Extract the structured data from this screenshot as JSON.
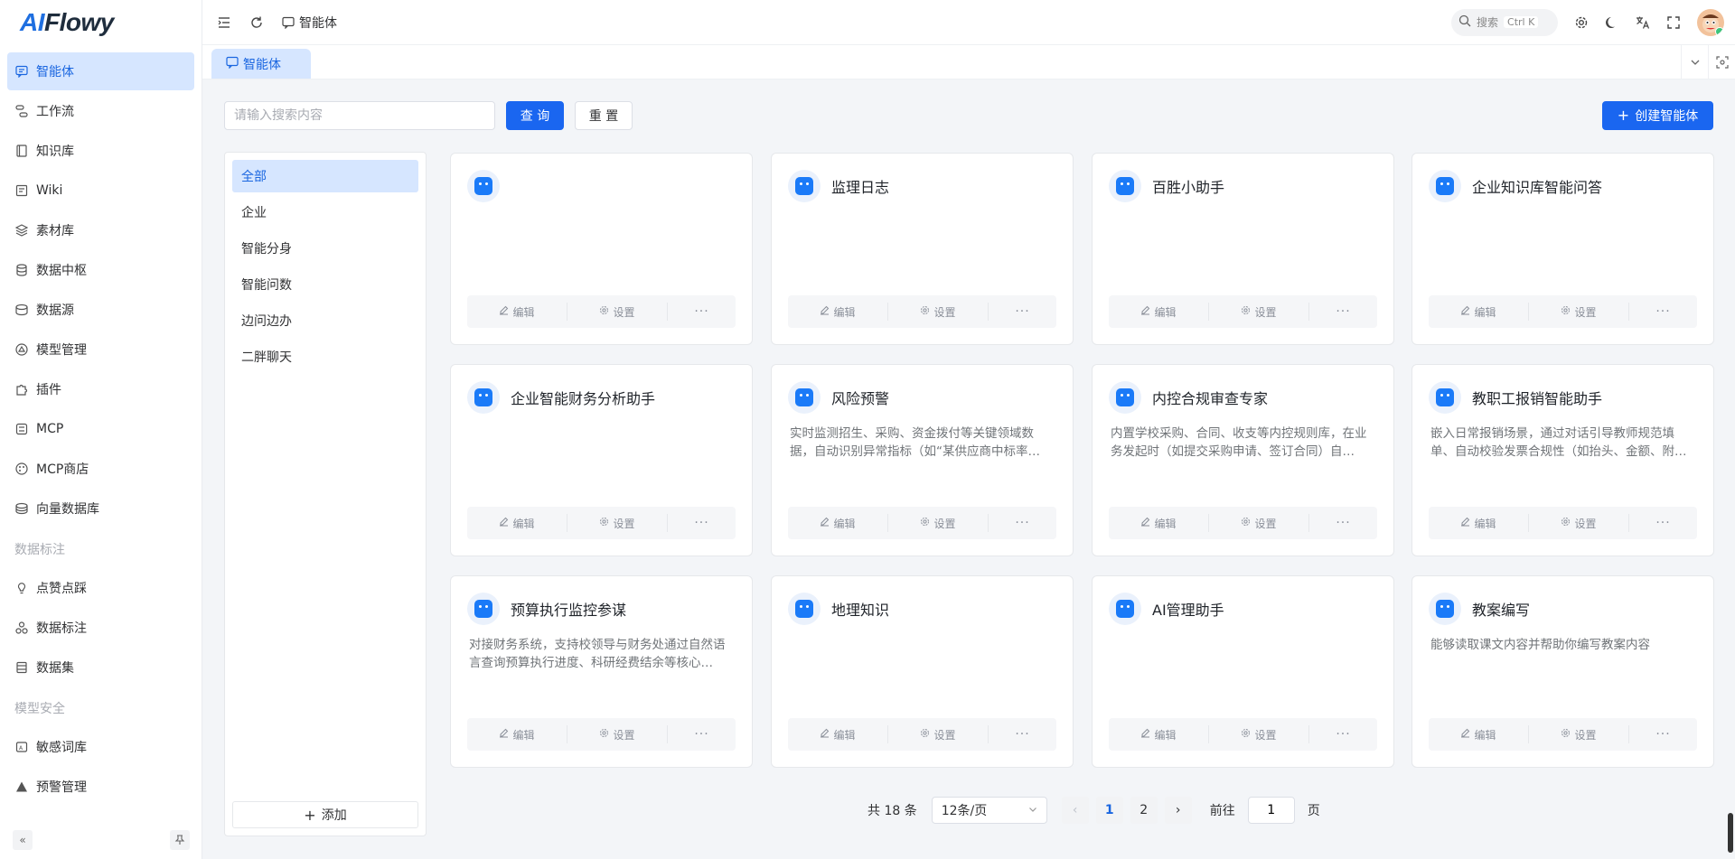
{
  "brand": {
    "logo_ai": "AI",
    "logo_rest": "Flowy"
  },
  "header": {
    "breadcrumb": "智能体",
    "search_label": "搜索",
    "search_shortcut": "Ctrl K"
  },
  "sidebar": {
    "items": [
      {
        "label": "智能体",
        "icon": "chat-icon",
        "active": true
      },
      {
        "label": "工作流",
        "icon": "workflow-icon"
      },
      {
        "label": "知识库",
        "icon": "book-icon"
      },
      {
        "label": "Wiki",
        "icon": "doc-icon"
      },
      {
        "label": "素材库",
        "icon": "layers-icon"
      },
      {
        "label": "数据中枢",
        "icon": "database-icon"
      },
      {
        "label": "数据源",
        "icon": "datasource-icon"
      },
      {
        "label": "模型管理",
        "icon": "model-icon"
      },
      {
        "label": "插件",
        "icon": "puzzle-icon"
      },
      {
        "label": "MCP",
        "icon": "mcp-icon"
      },
      {
        "label": "MCP商店",
        "icon": "palette-icon"
      },
      {
        "label": "向量数据库",
        "icon": "vector-db-icon"
      }
    ],
    "group_data_label": "数据标注",
    "data_items": [
      {
        "label": "点赞点踩",
        "icon": "bulb-icon"
      },
      {
        "label": "数据标注",
        "icon": "label-icon"
      },
      {
        "label": "数据集",
        "icon": "dataset-icon"
      }
    ],
    "group_safety_label": "模型安全",
    "safety_items": [
      {
        "label": "敏感词库",
        "icon": "sensitive-icon"
      },
      {
        "label": "预警管理",
        "icon": "warning-icon"
      }
    ]
  },
  "tabs": [
    {
      "label": "智能体"
    }
  ],
  "search": {
    "placeholder": "请输入搜索内容",
    "query_label": "查 询",
    "reset_label": "重 置",
    "create_label": "创建智能体"
  },
  "categories": {
    "items": [
      "全部",
      "企业",
      "智能分身",
      "智能问数",
      "边问边办",
      "二胖聊天"
    ],
    "active_index": 0,
    "add_label": "添加"
  },
  "card_actions": {
    "edit": "编辑",
    "settings": "设置",
    "more": "···"
  },
  "cards": [
    {
      "title": "",
      "desc": ""
    },
    {
      "title": "监理日志",
      "desc": ""
    },
    {
      "title": "百胜小助手",
      "desc": ""
    },
    {
      "title": "企业知识库智能问答",
      "desc": ""
    },
    {
      "title": "企业智能财务分析助手",
      "desc": ""
    },
    {
      "title": "风险预警",
      "desc": "实时监测招生、采购、资金拨付等关键领域数据，自动识别异常指标（如“某供应商中标率…"
    },
    {
      "title": "内控合规审查专家",
      "desc": "内置学校采购、合同、收支等内控规则库，在业务发起时（如提交采购申请、签订合同）自…"
    },
    {
      "title": "教职工报销智能助手",
      "desc": "嵌入日常报销场景，通过对话引导教师规范填单、自动校验发票合规性（如抬头、金额、附…"
    },
    {
      "title": "预算执行监控参谋",
      "desc": "对接财务系统，支持校领导与财务处通过自然语言查询预算执行进度、科研经费结余等核心…"
    },
    {
      "title": "地理知识",
      "desc": ""
    },
    {
      "title": "AI管理助手",
      "desc": ""
    },
    {
      "title": "教案编写",
      "desc": "能够读取课文内容并帮助你编写教案内容"
    }
  ],
  "pagination": {
    "total_text": "共 18 条",
    "page_size": "12条/页",
    "pages": [
      "1",
      "2"
    ],
    "current_page": "1",
    "goto_label": "前往",
    "goto_value": "1",
    "page_suffix": "页"
  },
  "colors": {
    "primary": "#1a66f0",
    "active_bg": "#d6e6ff"
  }
}
